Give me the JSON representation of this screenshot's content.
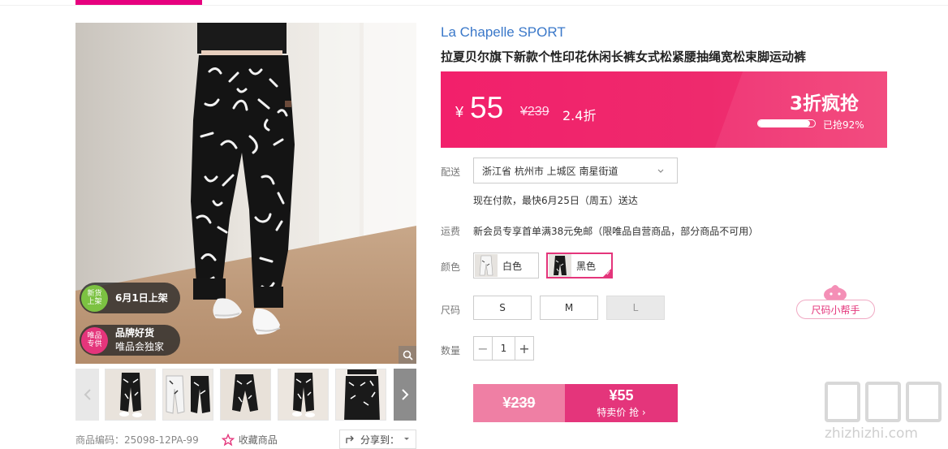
{
  "product": {
    "brand": "La Chapelle SPORT",
    "title": "拉夏贝尔旗下新款个性印花休闲长裤女式松紧腰抽绳宽松束脚运动裤"
  },
  "price": {
    "currency": "¥",
    "current": "55",
    "original": "¥239",
    "discount": "2.4折",
    "flash_title": "3折疯抢",
    "sold_percent": 92,
    "sold_text": "已抢92%"
  },
  "badges": {
    "new_icon": "新货\n上架",
    "new_text": "6月1日上架",
    "brand_icon": "唯品\n专供",
    "brand_line1": "品牌好货",
    "brand_line2": "唯品会独家"
  },
  "delivery": {
    "label": "配送",
    "address": "浙江省 杭州市 上城区 南星街道",
    "eta": "现在付款，最快6月25日（周五）送达"
  },
  "shipping": {
    "label": "运费",
    "text": "新会员专享首单满38元免邮（限唯品自营商品，部分商品不可用）"
  },
  "color": {
    "label": "颜色",
    "options": [
      {
        "label": "白色",
        "selected": false
      },
      {
        "label": "黑色",
        "selected": true
      }
    ]
  },
  "size": {
    "label": "尺码",
    "options": [
      {
        "label": "S",
        "disabled": false
      },
      {
        "label": "M",
        "disabled": false
      },
      {
        "label": "L",
        "disabled": true
      }
    ],
    "helper": "尺码小帮手"
  },
  "quantity": {
    "label": "数量",
    "value": "1",
    "minus": "−",
    "plus": "+"
  },
  "buy": {
    "original": "¥239",
    "price": "¥55",
    "label": "特卖价 抢 ›"
  },
  "meta": {
    "sku": "商品编码：25098-12PA-99",
    "favorite": "收藏商品",
    "share": "分享到："
  },
  "watermark": {
    "text": "zhizhizhi.com"
  },
  "colors": {
    "accent": "#e4357b",
    "banner": "#f2206b",
    "brand_link": "#3a78c9"
  }
}
